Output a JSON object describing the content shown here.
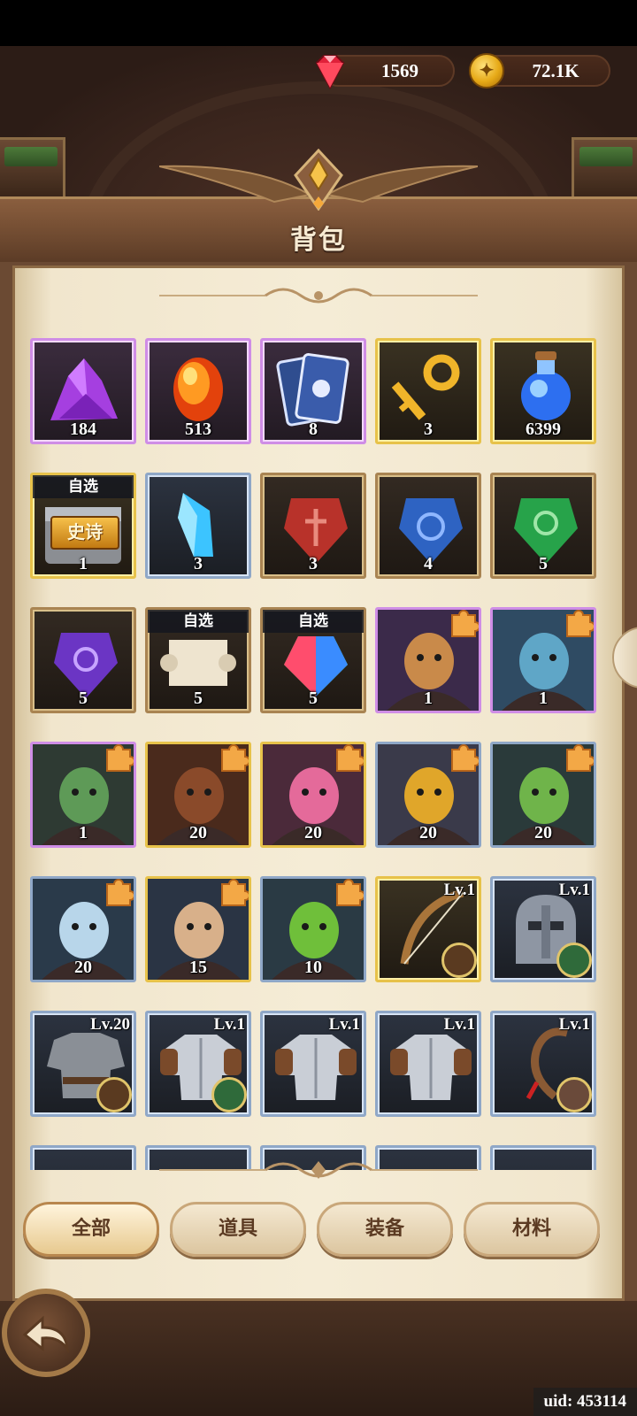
{
  "header": {
    "title": "背包"
  },
  "currency": {
    "gems": "1569",
    "gold": "72.1K"
  },
  "items": [
    {
      "count": "184",
      "frame": "purple",
      "kind": "purple-crystal"
    },
    {
      "count": "513",
      "frame": "purple",
      "kind": "fire-gem"
    },
    {
      "count": "8",
      "frame": "purple",
      "kind": "card-deck"
    },
    {
      "count": "3",
      "frame": "gold",
      "kind": "gold-key"
    },
    {
      "count": "6399",
      "frame": "gold",
      "kind": "blue-potion"
    },
    {
      "count": "1",
      "frame": "gold",
      "kind": "epic-chest",
      "select": "自选",
      "epic": "史诗"
    },
    {
      "count": "3",
      "frame": "blue",
      "kind": "blue-shard"
    },
    {
      "count": "3",
      "frame": "brown",
      "kind": "red-rune"
    },
    {
      "count": "4",
      "frame": "brown",
      "kind": "blue-rune"
    },
    {
      "count": "5",
      "frame": "brown",
      "kind": "green-rune"
    },
    {
      "count": "5",
      "frame": "brown",
      "kind": "purple-rune"
    },
    {
      "count": "5",
      "frame": "brown",
      "kind": "scroll",
      "select": "自选"
    },
    {
      "count": "5",
      "frame": "brown",
      "kind": "rainbow-gem",
      "select": "自选"
    },
    {
      "count": "1",
      "frame": "purple",
      "kind": "hero-lizard",
      "shard": true
    },
    {
      "count": "1",
      "frame": "purple",
      "kind": "hero-troll",
      "shard": true
    },
    {
      "count": "1",
      "frame": "purple",
      "kind": "hero-goblin-woman",
      "shard": true
    },
    {
      "count": "20",
      "frame": "gold",
      "kind": "hero-warrior",
      "shard": true
    },
    {
      "count": "20",
      "frame": "gold",
      "kind": "hero-pink-mage",
      "shard": true
    },
    {
      "count": "20",
      "frame": "blue",
      "kind": "hero-hooded",
      "shard": true
    },
    {
      "count": "20",
      "frame": "blue",
      "kind": "hero-elf",
      "shard": true
    },
    {
      "count": "20",
      "frame": "blue",
      "kind": "hero-old-lady",
      "shard": true
    },
    {
      "count": "15",
      "frame": "gold",
      "kind": "hero-engineer",
      "shard": true
    },
    {
      "count": "10",
      "frame": "blue",
      "kind": "hero-orc",
      "shard": true
    },
    {
      "level": "Lv.1",
      "frame": "gold",
      "kind": "bow",
      "owner": "lizard"
    },
    {
      "level": "Lv.1",
      "frame": "blue",
      "kind": "helmet",
      "owner": "goblin"
    },
    {
      "level": "Lv.20",
      "frame": "blue",
      "kind": "chainmail",
      "owner": "lizard"
    },
    {
      "level": "Lv.1",
      "frame": "blue",
      "kind": "plate-armor",
      "owner": "goblin"
    },
    {
      "level": "Lv.1",
      "frame": "blue",
      "kind": "plate-armor",
      "owner": "none"
    },
    {
      "level": "Lv.1",
      "frame": "blue",
      "kind": "plate-armor",
      "owner": "none"
    },
    {
      "level": "Lv.1",
      "frame": "blue",
      "kind": "whip",
      "owner": "girl"
    }
  ],
  "tabs": [
    "全部",
    "道具",
    "装备",
    "材料"
  ],
  "footer": {
    "uid": "uid: 453114"
  },
  "colors": {
    "parchment": "#f5ecd6",
    "frame_brown": "#6b4a33",
    "accent_gold": "#e7c24a"
  }
}
